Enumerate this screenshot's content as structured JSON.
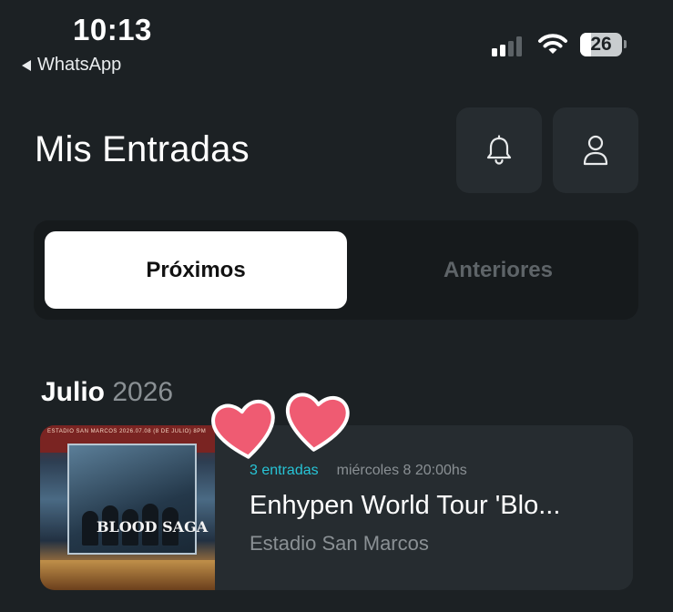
{
  "status_bar": {
    "time": "10:13",
    "back_app": "WhatsApp",
    "battery": "26",
    "battery_level": 0.26,
    "signal_bars_active": 2,
    "signal_bars_total": 4
  },
  "header": {
    "title": "Mis Entradas",
    "buttons": [
      "bell-icon",
      "user-icon"
    ]
  },
  "tabs": {
    "active": "Próximos",
    "inactive": "Anteriores"
  },
  "section": {
    "month": "Julio",
    "year": "2026"
  },
  "event": {
    "ticket_count": "3 entradas",
    "datetime": "miércoles 8 20:00hs",
    "title": "Enhypen World Tour 'Blo...",
    "venue": "Estadio San Marcos",
    "poster": {
      "top_text": "ESTADIO SAN MARCOS    2026.07.08 (8 DE JULIO) 8PM",
      "title": "BLOOD SAGA"
    }
  },
  "colors": {
    "background": "#1c2124",
    "card": "#262c30",
    "accent": "#27c4d6",
    "muted_text": "#8a9094",
    "heart": "#ef5b72"
  }
}
